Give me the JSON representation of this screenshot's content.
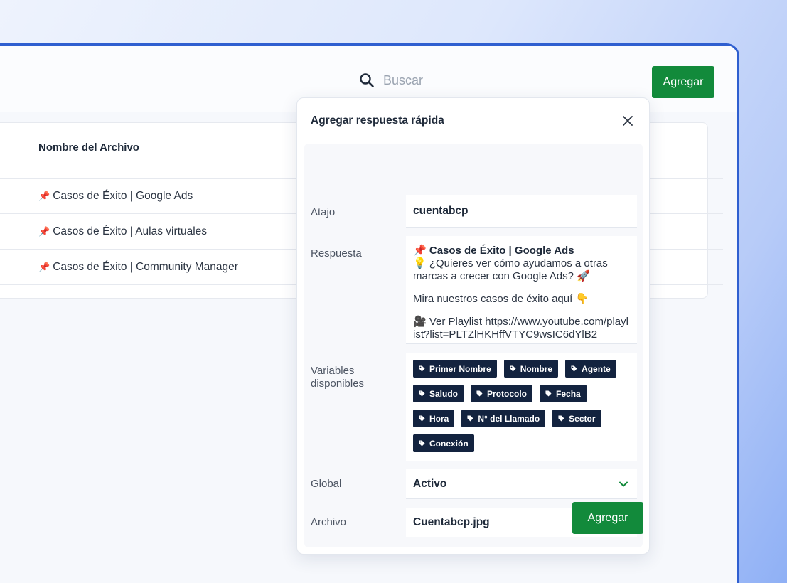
{
  "header": {
    "search": {
      "placeholder": "Buscar"
    },
    "add_label": "Agregar"
  },
  "table": {
    "column_header": "Nombre del Archivo",
    "rows": [
      {
        "icon": "📌",
        "label": "Casos de Éxito | Google Ads"
      },
      {
        "icon": "📌",
        "label": "Casos de Éxito | Aulas virtuales"
      },
      {
        "icon": "📌",
        "label": "Casos de Éxito | Community Manager"
      }
    ]
  },
  "modal": {
    "title": "Agregar respuesta rápida",
    "shortcut": {
      "label": "Atajo",
      "value": "cuentabcp"
    },
    "response": {
      "label": "Respuesta",
      "title_icon": "📌",
      "title": "Casos de Éxito | Google Ads",
      "line1": "💡 ¿Quieres ver cómo ayudamos a otras marcas a crecer con Google Ads? 🚀",
      "line2": "Mira nuestros casos de éxito aquí 👇",
      "line3": "🎥 Ver Playlist https://www.youtube.com/playlist?list=PLTZlHKHffVTYC9wsIC6dYlB2"
    },
    "variables": {
      "label": "Variables disponibles",
      "items": [
        "Primer Nombre",
        "Nombre",
        "Agente",
        "Saludo",
        "Protocolo",
        "Fecha",
        "Hora",
        "N° del Llamado",
        "Sector",
        "Conexión"
      ]
    },
    "global": {
      "label": "Global",
      "value": "Activo"
    },
    "file": {
      "label": "Archivo",
      "value": "Cuentabcp.jpg"
    },
    "submit_label": "Agregar"
  },
  "colors": {
    "accent_green": "#128a3b",
    "chip_navy": "#13233f",
    "window_border": "#2f5fd0"
  },
  "icons": {
    "search": "search-icon",
    "close": "close-icon",
    "tag": "tag-icon",
    "chevron": "chevron-down-icon",
    "attach": "paperclip-add-icon"
  }
}
